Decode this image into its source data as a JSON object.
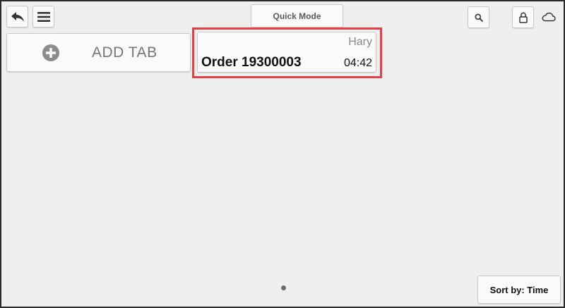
{
  "toolbar": {
    "back_icon": "back-arrow-icon",
    "menu_icon": "hamburger-menu-icon",
    "quick_mode_label": "Quick Mode",
    "search_icon": "search-icon",
    "lock_icon": "lock-icon",
    "cloud_icon": "cloud-icon"
  },
  "tabs": {
    "add_tab_label": "ADD TAB",
    "add_tab_icon": "plus-circle-icon",
    "orders": [
      {
        "user": "Hary",
        "title": "Order 19300003",
        "time": "04:42"
      }
    ]
  },
  "footer": {
    "sort_label": "Sort by: Time"
  },
  "colors": {
    "background": "#efefef",
    "highlight": "#e64046",
    "button_bg": "#fafafa"
  }
}
